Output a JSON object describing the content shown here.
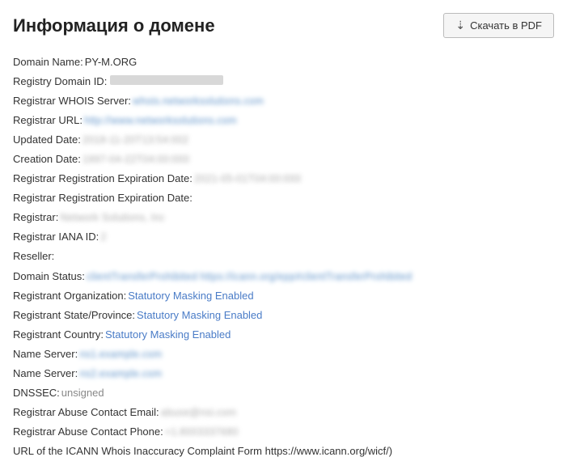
{
  "header": {
    "title": "Информация о домене",
    "download_label": "Скачать в PDF"
  },
  "fields": [
    {
      "label": "Domain Name:",
      "value": "PY-M.ORG",
      "type": "plain-domain"
    },
    {
      "label": "Registry Domain ID:",
      "value": "redacted_long",
      "type": "redacted"
    },
    {
      "label": "Registrar WHOIS Server:",
      "value": "whois.networksolutions.com",
      "type": "link-blur"
    },
    {
      "label": "Registrar URL:",
      "value": "http://www.networksolutions.com",
      "type": "link-blur"
    },
    {
      "label": "Updated Date:",
      "value": "2018-11-20T13:54:002",
      "type": "blur"
    },
    {
      "label": "Creation Date:",
      "value": "1997-04-22T04:00:000",
      "type": "blur"
    },
    {
      "label": "Registrar Registration Expiration Date:",
      "value": "2021-05-01T04:00:000",
      "type": "blur"
    },
    {
      "label": "Registrar Registration Expiration Date:",
      "value": "",
      "type": "empty"
    },
    {
      "label": "Registrar:",
      "value": "Network Solutions, Inc",
      "type": "blur"
    },
    {
      "label": "Registrar IANA ID:",
      "value": "2",
      "type": "blur"
    },
    {
      "label": "Reseller:",
      "value": "",
      "type": "empty"
    },
    {
      "label": "Domain Status:",
      "value": "clientTransferProhibited https://icann.org/epp#clientTransferProhibited",
      "type": "link-blur"
    },
    {
      "label": "Registrant Organization:",
      "value": "Statutory Masking Enabled",
      "type": "link-blue"
    },
    {
      "label": "Registrant State/Province:",
      "value": "Statutory Masking Enabled",
      "type": "link-blue"
    },
    {
      "label": "Registrant Country:",
      "value": "Statutory Masking Enabled",
      "type": "link-blue"
    },
    {
      "label": "Name Server:",
      "value": "ns1.example.com",
      "type": "link-blur"
    },
    {
      "label": "Name Server:",
      "value": "ns2.example.com",
      "type": "link-blur"
    },
    {
      "label": "DNSSEC:",
      "value": "unsigned",
      "type": "plain"
    },
    {
      "label": "Registrar Abuse Contact Email:",
      "value": "abuse@nsi.com",
      "type": "blur"
    },
    {
      "label": "Registrar Abuse Contact Phone:",
      "value": "+1.8003337680",
      "type": "blur"
    },
    {
      "label": "URL of the ICANN Whois Inaccuracy Complaint Form https://www.icann.org/wicf/)",
      "value": "",
      "type": "label-only"
    }
  ]
}
